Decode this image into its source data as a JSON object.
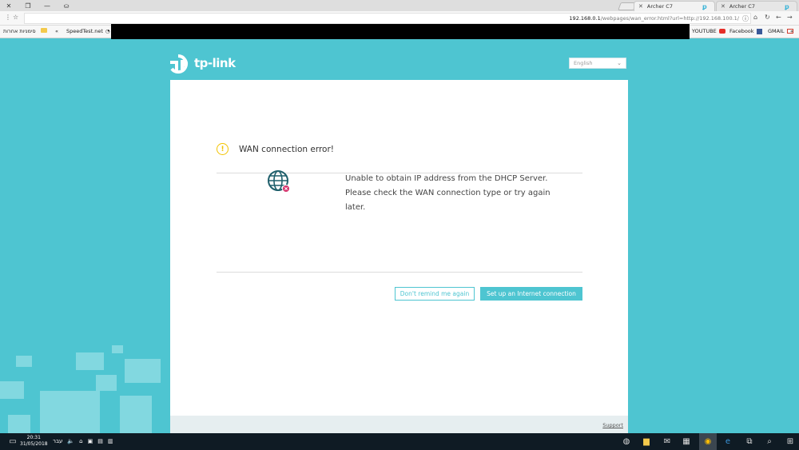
{
  "browser": {
    "tabs": [
      {
        "label": "Archer C7",
        "active": true
      },
      {
        "label": "Archer C7",
        "active": false
      }
    ],
    "url_host": "192.168.0.1",
    "url_rest": "/webpages/wan_error.html?url=http://192.168.100.1/",
    "bookmarks_left": [
      {
        "label": "סימניות אחרות"
      },
      {
        "label": "«"
      },
      {
        "label": "SpeedTest.net"
      }
    ],
    "bookmarks_right": [
      {
        "label": "YOUTUBE"
      },
      {
        "label": "Facebook"
      },
      {
        "label": "GMAIL"
      },
      {
        "label": "«"
      }
    ]
  },
  "page": {
    "logo": "tp-link",
    "language": "English",
    "error_title": "WAN connection error!",
    "error_message_lines": [
      "Unable to obtain IP address from the DHCP Server.",
      "Please check the WAN connection type or try again",
      "later."
    ],
    "dont_remind_label": "Don't remind me again",
    "setup_label": "Set up an Internet connection",
    "support_label": "Support"
  },
  "taskbar": {
    "time": "20:31",
    "date": "31/05/2018",
    "lang": "עבר"
  },
  "colors": {
    "brand": "#4ec5d1",
    "warning": "#f2c300",
    "globe": "#1f5f6b",
    "error_badge": "#d6336c"
  }
}
